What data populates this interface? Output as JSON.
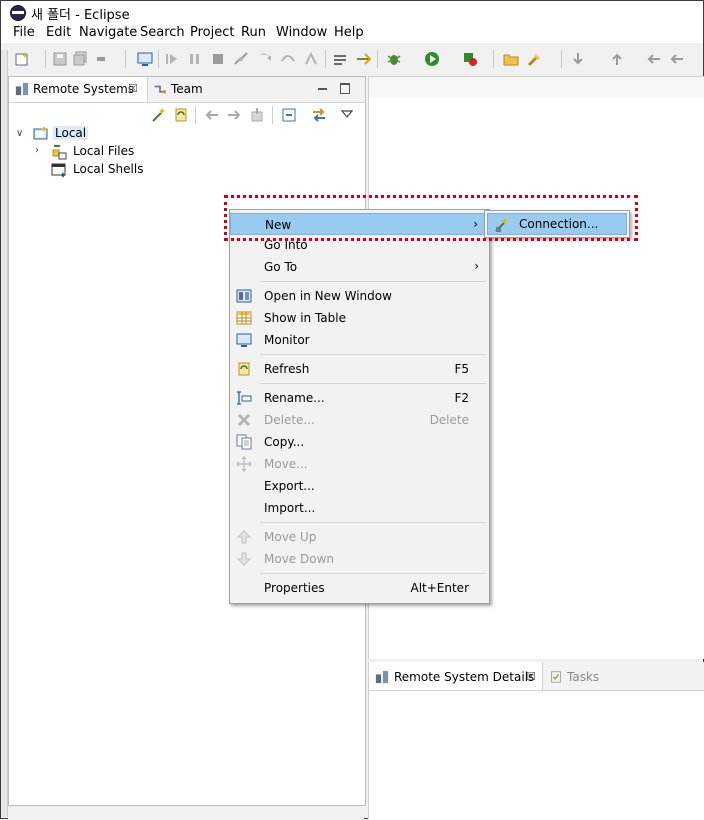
{
  "window": {
    "title": "새 폴더 - Eclipse"
  },
  "menubar": [
    "File",
    "Edit",
    "Navigate",
    "Search",
    "Project",
    "Run",
    "Window",
    "Help"
  ],
  "left_view": {
    "tabs": [
      {
        "label": "Remote Systems",
        "close": "☒"
      },
      {
        "label": "Team"
      }
    ],
    "tree": {
      "root": "Local",
      "children": [
        "Local Files",
        "Local Shells"
      ]
    }
  },
  "bottom_view": {
    "tabs": [
      {
        "label": "Remote System Details",
        "close": "☒"
      },
      {
        "label": "Tasks"
      }
    ]
  },
  "context_menu": {
    "items": [
      {
        "label": "New",
        "shortcut": "",
        "submenu": "›",
        "highlighted": true
      },
      {
        "label": "Go Into",
        "shortcut": ""
      },
      {
        "label": "Go To",
        "shortcut": "",
        "submenu": "›"
      },
      {
        "label": "Open in New Window",
        "shortcut": ""
      },
      {
        "label": "Show in Table",
        "shortcut": ""
      },
      {
        "label": "Monitor",
        "shortcut": ""
      },
      {
        "label": "Refresh",
        "shortcut": "F5"
      },
      {
        "label": "Rename...",
        "shortcut": "F2"
      },
      {
        "label": "Delete...",
        "shortcut": "Delete",
        "disabled": true
      },
      {
        "label": "Copy...",
        "shortcut": ""
      },
      {
        "label": "Move...",
        "shortcut": "",
        "disabled": true
      },
      {
        "label": "Export...",
        "shortcut": ""
      },
      {
        "label": "Import...",
        "shortcut": ""
      },
      {
        "label": "Move Up",
        "shortcut": "",
        "disabled": true
      },
      {
        "label": "Move Down",
        "shortcut": "",
        "disabled": true
      },
      {
        "label": "Properties",
        "shortcut": "Alt+Enter"
      }
    ]
  },
  "submenu": {
    "label": "Connection..."
  },
  "colors": {
    "highlight": "#99cbf1",
    "annotation": "#c8001c"
  }
}
